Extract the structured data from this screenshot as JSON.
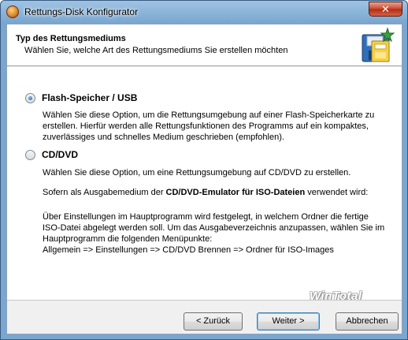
{
  "window": {
    "title": "Rettungs-Disk Konfigurator",
    "close_label": "✕"
  },
  "header": {
    "title": "Typ des Rettungsmediums",
    "subtitle": "Wählen Sie, welche Art des Rettungsmediums Sie erstellen möchten"
  },
  "options": [
    {
      "label": "Flash-Speicher / USB",
      "selected": true,
      "description_lines": [
        "Wählen Sie diese Option, um die Rettungsumgebung auf einer Flash-Speicherkarte zu",
        "erstellen. Hierfür werden alle Rettungsfunktionen des Programms auf ein kompaktes,",
        "zuverlässiges und schnelles Medium geschrieben (empfohlen)."
      ]
    },
    {
      "label": "CD/DVD",
      "selected": false,
      "description_line1": "Wählen Sie diese Option, um eine Rettungsumgebung auf CD/DVD zu erstellen.",
      "emulator_prefix": "Sofern als Ausgabemedium der ",
      "emulator_bold": "CD/DVD-Emulator für ISO-Dateien",
      "emulator_suffix": " verwendet wird:",
      "detail_lines": [
        "Über Einstellungen im Hauptprogramm wird festgelegt, in welchem Ordner die fertige",
        "ISO-Datei abgelegt werden soll. Um das Ausgabeverzeichnis anzupassen, wählen Sie im",
        "Hauptprogramm die folgenden Menüpunkte:",
        "Allgemein => Einstellungen => CD/DVD Brennen => Ordner für ISO-Images"
      ]
    }
  ],
  "watermark": "WinTotal",
  "buttons": {
    "back": "< Zurück",
    "next": "Weiter >",
    "cancel": "Abbrechen"
  }
}
